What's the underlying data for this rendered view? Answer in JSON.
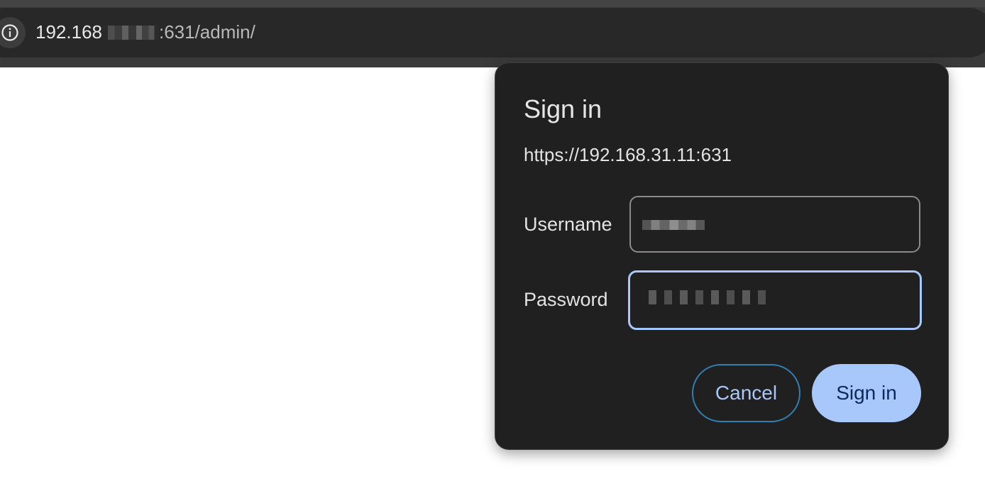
{
  "browser": {
    "site_info_icon": "info-icon",
    "url": {
      "host_prefix": "192.168",
      "host_redacted": true,
      "port_path": ":631/admin/"
    }
  },
  "dialog": {
    "title": "Sign in",
    "origin": "https://192.168.31.11:631",
    "username_label": "Username",
    "username_value_redacted": true,
    "password_label": "Password",
    "password_value_redacted": true,
    "cancel_label": "Cancel",
    "signin_label": "Sign in"
  },
  "colors": {
    "dialog_bg": "#202020",
    "accent": "#a8c7fa",
    "cancel_border": "#2f7fb1",
    "page_bg": "#ffffff",
    "toolbar_bg": "#3a3a3a"
  }
}
